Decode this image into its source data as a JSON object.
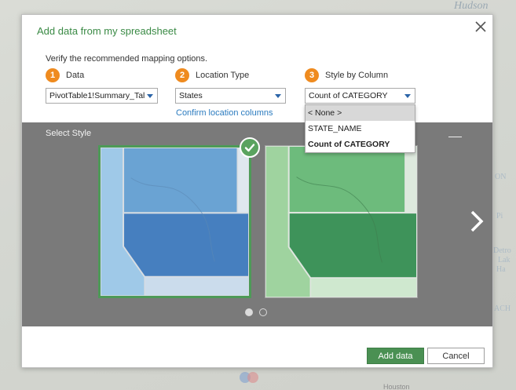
{
  "map": {
    "top_label": "Hudson",
    "side_labels": [
      "ON",
      "Pi",
      "Detro",
      "Lak",
      "Ha",
      "ACH"
    ],
    "bottom_label": "Houston"
  },
  "dialog": {
    "title": "Add data from my spreadsheet",
    "instructions": "Verify the recommended mapping options.",
    "steps": [
      {
        "number": "1",
        "label": "Data",
        "value": "PivotTable1!Summary_Tal"
      },
      {
        "number": "2",
        "label": "Location Type",
        "value": "States"
      },
      {
        "number": "3",
        "label": "Style by Column",
        "value": "Count of CATEGORY"
      }
    ],
    "confirm_link": "Confirm location columns",
    "style_dropdown_options": [
      "< None >",
      "STATE_NAME",
      "Count of CATEGORY"
    ],
    "select_style_label": "Select Style",
    "styles": [
      {
        "name": "blue-style",
        "selected": true
      },
      {
        "name": "green-style",
        "selected": false
      }
    ],
    "pager": {
      "current": 1,
      "total": 2
    },
    "buttons": {
      "add": "Add data",
      "cancel": "Cancel"
    }
  },
  "colors": {
    "accent_green": "#4a9053",
    "step_orange": "#ef8b1f",
    "link_blue": "#2b7bbf",
    "panel_gray": "#7a7a7a"
  }
}
